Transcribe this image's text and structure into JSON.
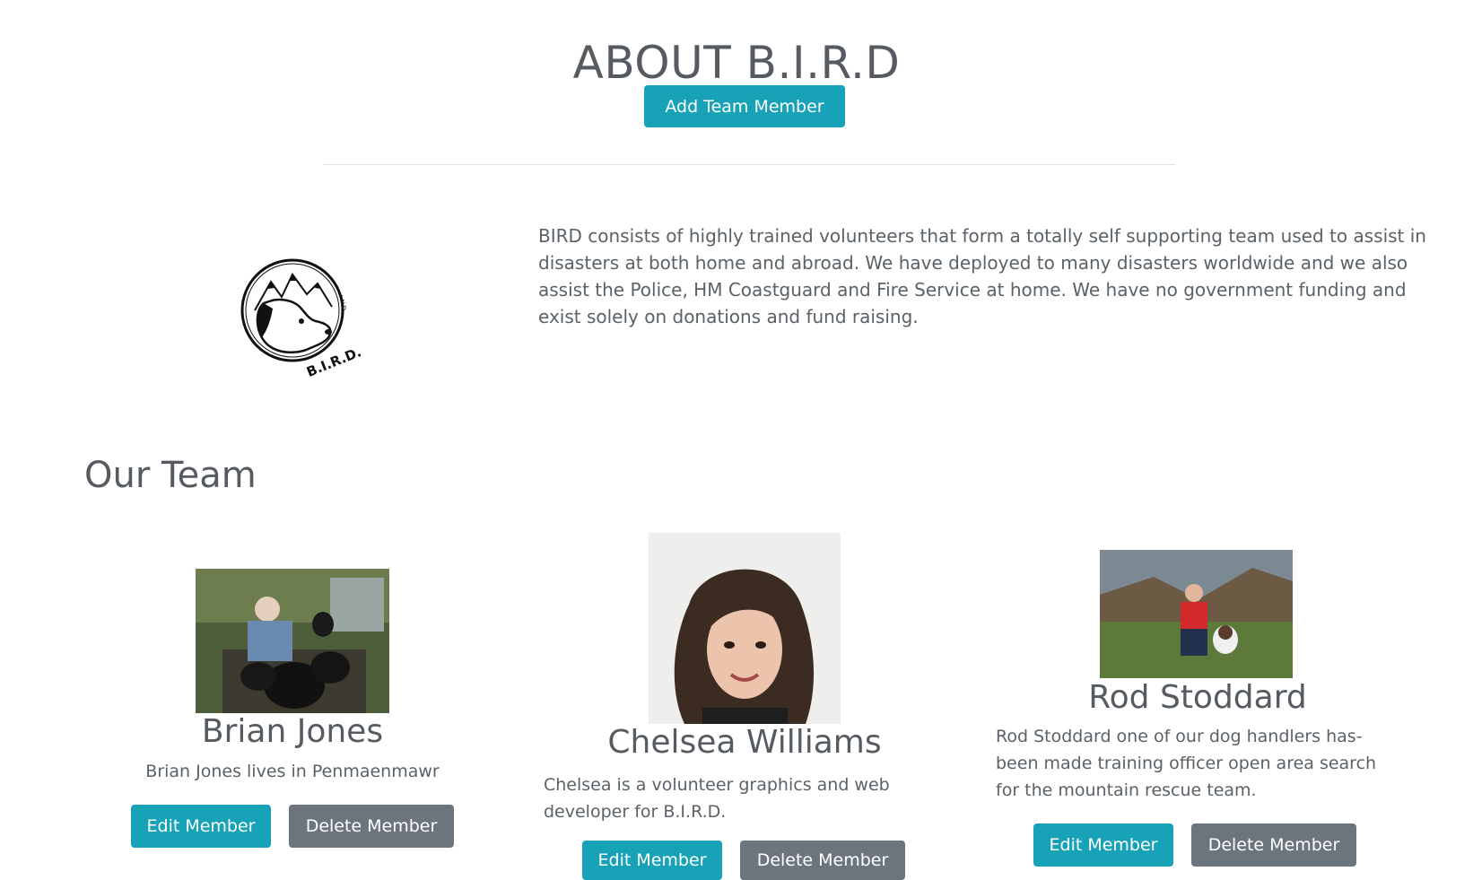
{
  "header": {
    "title": "ABOUT B.I.R.D",
    "add_button_label": "Add Team Member"
  },
  "about": {
    "logo_icon": "bird-logo-icon",
    "text": "BIRD consists of highly trained volunteers that form a totally self supporting team used to assist in disasters at both home and abroad. We have deployed to many disasters worldwide and we also assist the Police, HM Coastguard and Fire Service at home. We have no government funding and exist solely on donations and fund raising."
  },
  "team": {
    "title": "Our Team",
    "edit_label": "Edit Member",
    "delete_label": "Delete Member",
    "members": [
      {
        "name": "Brian Jones",
        "description": "Brian Jones lives in Penmaenmawr"
      },
      {
        "name": "Chelsea Williams",
        "description": "Chelsea is a volunteer graphics and web developer for B.I.R.D."
      },
      {
        "name": "Rod Stoddard",
        "description": "Rod Stoddard one of our dog handlers has-been made training officer open area search for the mountain rescue team."
      }
    ]
  },
  "colors": {
    "primary": "#17a2b8",
    "secondary": "#6c757d",
    "text": "#555b60"
  }
}
